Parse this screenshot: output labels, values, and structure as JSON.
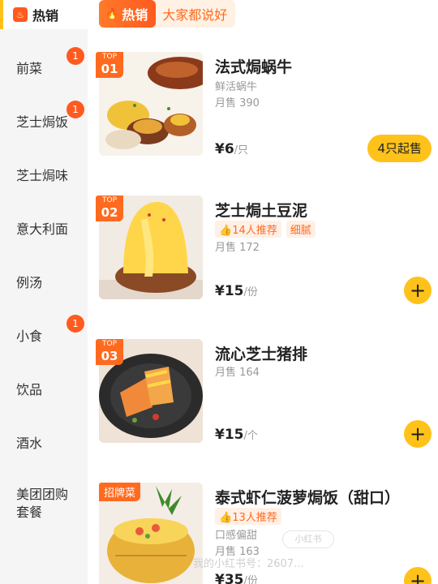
{
  "sidebar": {
    "active": {
      "label": "热销",
      "icon": "flame-icon"
    },
    "items": [
      {
        "label": "前菜",
        "badge": "1"
      },
      {
        "label": "芝士焗饭",
        "badge": "1"
      },
      {
        "label": "芝士焗味",
        "badge": ""
      },
      {
        "label": "意大利面",
        "badge": ""
      },
      {
        "label": "例汤",
        "badge": ""
      },
      {
        "label": "小食",
        "badge": "1"
      },
      {
        "label": "饮品",
        "badge": ""
      },
      {
        "label": "酒水",
        "badge": ""
      },
      {
        "label": "美团团购套餐",
        "line1": "美团团购",
        "line2": "套餐",
        "badge": ""
      }
    ]
  },
  "section": {
    "tag": "热销",
    "subtitle": "大家都说好"
  },
  "products": [
    {
      "rank_top": "TOP",
      "rank_num": "01",
      "name": "法式焗蜗牛",
      "desc": "鲜活蜗牛",
      "sales": "月售 390",
      "price": "¥6",
      "unit": "/只",
      "action": "4只起售"
    },
    {
      "rank_top": "TOP",
      "rank_num": "02",
      "name": "芝士焗土豆泥",
      "tag1": "14人推荐",
      "tag2": "细腻",
      "sales": "月售 172",
      "price": "¥15",
      "unit": "/份",
      "action": "+"
    },
    {
      "rank_top": "TOP",
      "rank_num": "03",
      "name": "流心芝士猪排",
      "sales": "月售 164",
      "price": "¥15",
      "unit": "/个",
      "action": "+"
    },
    {
      "badge": "招牌菜",
      "name": "泰式虾仁菠萝焗饭（甜口）",
      "tag1": "13人推荐",
      "desc": "口感偏甜",
      "sales": "月售 163",
      "price": "¥35",
      "unit": "/份",
      "action": "+"
    }
  ],
  "watermark": {
    "logo": "小红书",
    "text": "我的小红书号：2607..."
  },
  "colors": {
    "accent": "#ffc21a",
    "hot": "#ff5a1f",
    "sidebar_bg": "#f5f5f5"
  }
}
